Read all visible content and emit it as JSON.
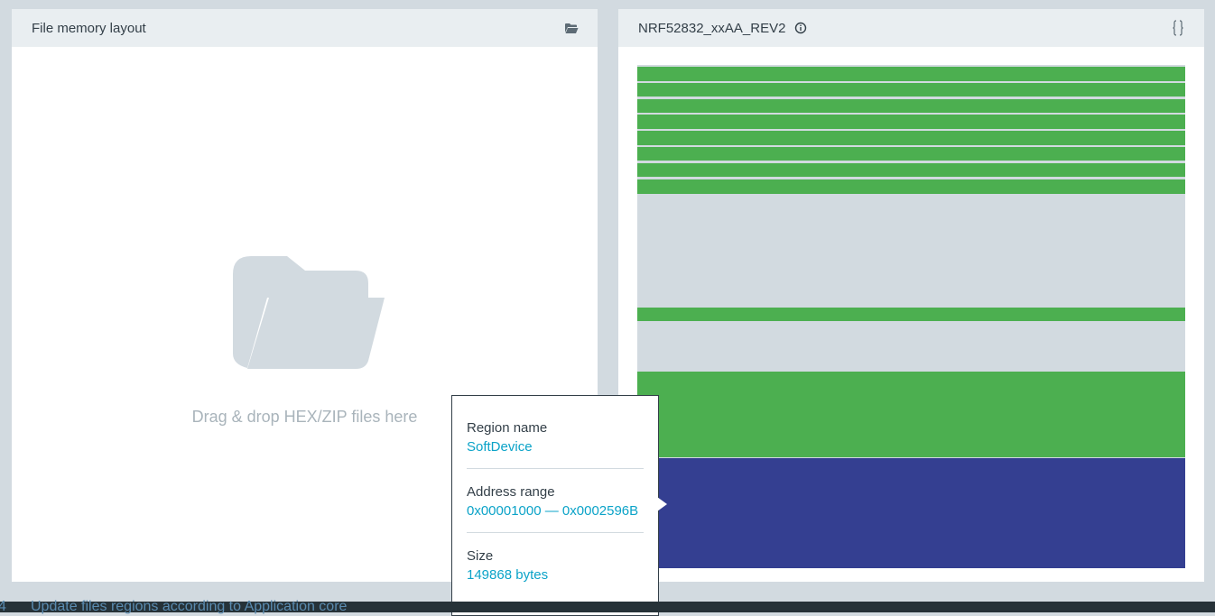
{
  "left_panel": {
    "title": "File memory layout",
    "header_icon": "folder-open-icon",
    "dropzone_icon": "folder-open-icon",
    "dropzone_text": "Drag & drop HEX/ZIP files here"
  },
  "right_panel": {
    "title": "NRF52832_xxAA_REV2",
    "info_icon": "info-icon",
    "header_icon": "code-braces-icon",
    "memory_regions": [
      {
        "kind": "written",
        "color": "#4caf50"
      },
      {
        "kind": "written",
        "color": "#4caf50"
      },
      {
        "kind": "written",
        "color": "#4caf50"
      },
      {
        "kind": "written",
        "color": "#4caf50"
      },
      {
        "kind": "written",
        "color": "#4caf50"
      },
      {
        "kind": "written",
        "color": "#4caf50"
      },
      {
        "kind": "written",
        "color": "#4caf50"
      },
      {
        "kind": "written",
        "color": "#4caf50"
      },
      {
        "kind": "empty",
        "color": "#d2dae0"
      },
      {
        "kind": "written",
        "color": "#4caf50"
      },
      {
        "kind": "empty",
        "color": "#d2dae0"
      },
      {
        "kind": "written",
        "color": "#4caf50"
      },
      {
        "kind": "softdevice",
        "color": "#343f91"
      }
    ]
  },
  "tooltip": {
    "region_name_label": "Region name",
    "region_name_value": "SoftDevice",
    "address_range_label": "Address range",
    "address_range_value": "0x00001000 — 0x0002596B",
    "size_label": "Size",
    "size_value": "149868 bytes"
  },
  "log": {
    "line_number": "4",
    "message": "Update files regions according to Application core"
  },
  "colors": {
    "accent": "#0ba3c8",
    "written_region": "#4caf50",
    "softdevice_region": "#343f91",
    "empty_region": "#d2dae0"
  }
}
